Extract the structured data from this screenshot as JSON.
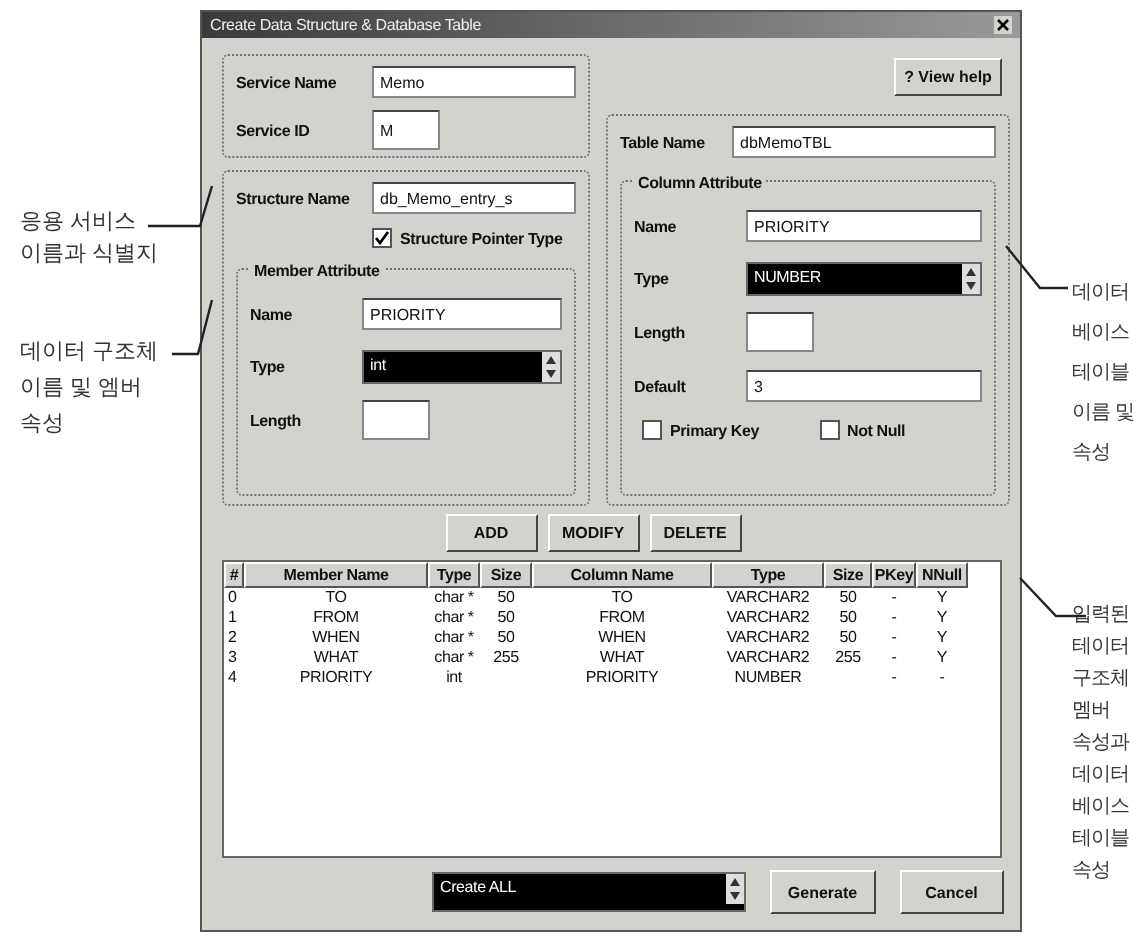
{
  "window": {
    "title": "Create Data Structure & Database Table"
  },
  "service": {
    "fields": [
      {
        "label": "Service Name",
        "value": "Memo",
        "kind": "text"
      },
      {
        "label": "Service ID",
        "value": "M",
        "kind": "short"
      }
    ]
  },
  "help_button": "? View help",
  "structure": {
    "label": "Structure Name",
    "value": "db_Memo_entry_s",
    "pointer_checkbox": {
      "label": "Structure Pointer Type",
      "checked": true
    },
    "member_attribute": {
      "title": "Member Attribute",
      "fields": [
        {
          "label": "Name",
          "value": "PRIORITY",
          "kind": "text"
        },
        {
          "label": "Type",
          "value": "int",
          "kind": "combo"
        },
        {
          "label": "Length",
          "kind": "short"
        }
      ]
    }
  },
  "table": {
    "label": "Table Name",
    "value": "dbMemoTBL",
    "column_attribute": {
      "title": "Column Attribute",
      "fields": [
        {
          "label": "Name",
          "value": "PRIORITY",
          "kind": "text"
        },
        {
          "label": "Type",
          "value": "NUMBER",
          "kind": "combo"
        },
        {
          "label": "Length",
          "kind": "short"
        },
        {
          "label": "Default",
          "value": "3",
          "kind": "text"
        }
      ],
      "checkboxes": [
        {
          "label": "Primary Key",
          "checked": false
        },
        {
          "label": "Not Null",
          "checked": false
        }
      ]
    }
  },
  "action_buttons": [
    "ADD",
    "MODIFY",
    "DELETE"
  ],
  "list": {
    "columns": [
      "#",
      "Member Name",
      "Type",
      "Size",
      "Column Name",
      "Type",
      "Size",
      "PKey",
      "NNull"
    ],
    "rows": [
      [
        "0",
        "TO",
        "char *",
        "50",
        "TO",
        "VARCHAR2",
        "50",
        "-",
        "Y"
      ],
      [
        "1",
        "FROM",
        "char *",
        "50",
        "FROM",
        "VARCHAR2",
        "50",
        "-",
        "Y"
      ],
      [
        "2",
        "WHEN",
        "char *",
        "50",
        "WHEN",
        "VARCHAR2",
        "50",
        "-",
        "Y"
      ],
      [
        "3",
        "WHAT",
        "char *",
        "255",
        "WHAT",
        "VARCHAR2",
        "255",
        "-",
        "Y"
      ],
      [
        "4",
        "PRIORITY",
        "int",
        "",
        "PRIORITY",
        "NUMBER",
        "",
        "-",
        "-"
      ]
    ]
  },
  "mode_combo": {
    "value": "Create ALL"
  },
  "bottom_buttons": [
    "Generate",
    "Cancel"
  ],
  "annotations": [
    {
      "kind": "left",
      "text": "응용 서비스\n이름과 식별지"
    },
    {
      "kind": "left",
      "text": "데이터 구조체\n이름 및 엠버\n속성"
    },
    {
      "kind": "right",
      "text": "데이터\n베이스\n테이블\n이름 및\n속성"
    },
    {
      "kind": "right",
      "text": "입력된\n테이터\n구조체\n멤버\n속성과\n데이터\n베이스\n테이블\n속성"
    }
  ]
}
